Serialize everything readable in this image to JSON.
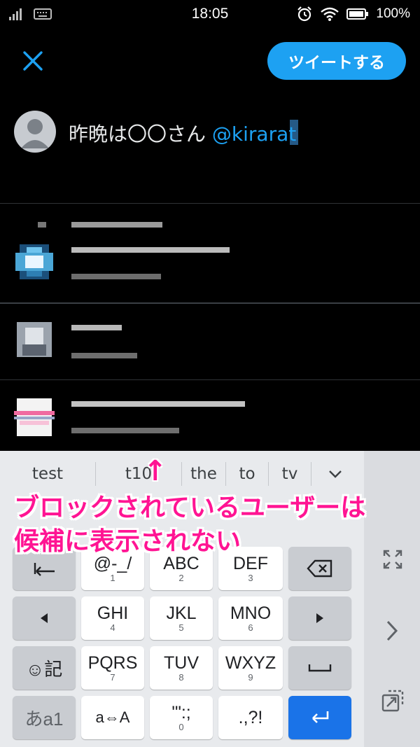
{
  "status": {
    "time": "18:05",
    "battery": "100%",
    "icons": [
      "signal-icon",
      "keyboard-icon",
      "alarm-icon",
      "wifi-icon",
      "battery-icon"
    ]
  },
  "compose": {
    "tweet_button": "ツイートする",
    "text_plain": "昨晩は〇〇さん ",
    "text_mention": "@kirarat"
  },
  "keyboard": {
    "suggestions": [
      "test",
      "t10",
      "the",
      "to",
      "tv"
    ],
    "rows": [
      [
        {
          "label": "@-_/",
          "sub": "1"
        },
        {
          "label": "ABC",
          "sub": "2"
        },
        {
          "label": "DEF",
          "sub": "3"
        }
      ],
      [
        {
          "label": "GHI",
          "sub": "4"
        },
        {
          "label": "JKL",
          "sub": "5"
        },
        {
          "label": "MNO",
          "sub": "6"
        }
      ],
      [
        {
          "label": "PQRS",
          "sub": "7"
        },
        {
          "label": "TUV",
          "sub": "8"
        },
        {
          "label": "WXYZ",
          "sub": "9"
        }
      ],
      [
        {
          "label": "a⇔A",
          "sub": ""
        },
        {
          "label": "'\":;",
          "sub": "0"
        },
        {
          "label": ".,?!",
          "sub": ""
        }
      ]
    ],
    "emoji_key": "☺記",
    "mode_key": "あa1"
  },
  "annotation": {
    "arrow": "↑",
    "line1": "ブロックされているユーザーは",
    "line2": "候補に表示されない"
  },
  "colors": {
    "accent": "#1da1f2",
    "annotation": "#ff1493",
    "enter": "#1a73e8"
  }
}
